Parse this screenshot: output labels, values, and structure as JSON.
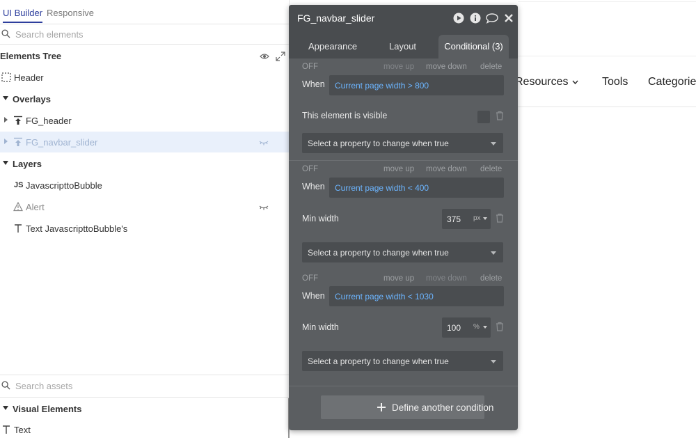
{
  "left_panel": {
    "tabs": {
      "active": "UI Builder",
      "inactive": "Responsive"
    },
    "search_placeholder": "Search elements",
    "tree_title": "Elements Tree",
    "rows": [
      {
        "label": "Header",
        "icon": "group-dashed-icon"
      },
      {
        "label": "Overlays",
        "icon": "caret-down-icon"
      },
      {
        "label": "FG_header",
        "icon": "floating-group-icon"
      },
      {
        "label": "FG_navbar_slider",
        "icon": "floating-group-icon",
        "selected": true
      },
      {
        "label": "Layers",
        "icon": "caret-down-icon"
      },
      {
        "label": "JavascripttoBubble",
        "icon": "js-icon",
        "icon_text": "JS"
      },
      {
        "label": "Alert",
        "icon": "alert-icon"
      },
      {
        "label": "Text JavascripttoBubble's",
        "icon": "text-icon"
      }
    ],
    "assets_placeholder": "Search assets",
    "visual_elements": "Visual Elements",
    "text_item": "Text"
  },
  "page_nav": {
    "resources": "Resources",
    "tools": "Tools",
    "categories": "Categories"
  },
  "editor": {
    "title": "FG_navbar_slider",
    "tabs": [
      "Appearance",
      "Layout",
      "Conditional (3)"
    ],
    "conditions": [
      {
        "status": "OFF",
        "move_up": "move up",
        "move_down": "move down",
        "delete": "delete",
        "when_label": "When",
        "expression": "Current page width > 800",
        "property": "This element is visible",
        "select_placeholder": "Select a property to change when true"
      },
      {
        "status": "OFF",
        "move_up": "move up",
        "move_down": "move down",
        "delete": "delete",
        "when_label": "When",
        "expression": "Current page width < 400",
        "property": "Min width",
        "value": "375",
        "unit": "px",
        "select_placeholder": "Select a property to change when true"
      },
      {
        "status": "OFF",
        "move_up": "move up",
        "move_down": "move down",
        "delete": "delete",
        "when_label": "When",
        "expression": "Current page width < 1030",
        "property": "Min width",
        "value": "100",
        "unit": "%",
        "select_placeholder": "Select a property to change when true"
      }
    ],
    "define_button": "Define another condition"
  },
  "colors": {
    "accent": "#2d3e9d",
    "editor_bg": "#5b5e61",
    "expression": "#6cb5ff",
    "selected_row": "#e9f0fb"
  }
}
